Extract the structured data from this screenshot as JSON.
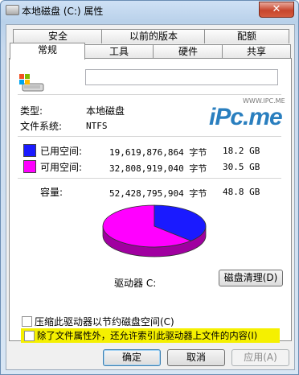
{
  "window": {
    "title": "本地磁盘 (C:) 属性",
    "close_glyph": "✕"
  },
  "tabs_row1": [
    "安全",
    "以前的版本",
    "配额"
  ],
  "tabs_row2": [
    "常规",
    "工具",
    "硬件",
    "共享"
  ],
  "general": {
    "name_value": "",
    "type_label": "类型:",
    "type_value": "本地磁盘",
    "fs_label": "文件系统:",
    "fs_value": "NTFS",
    "used_label": "已用空间:",
    "used_bytes": "19,619,876,864 字节",
    "used_gb": "18.2 GB",
    "free_label": "可用空间:",
    "free_bytes": "32,808,919,040 字节",
    "free_gb": "30.5 GB",
    "cap_label": "容量:",
    "cap_bytes": "52,428,795,904 字节",
    "cap_gb": "48.8 GB",
    "drive_label": "驱动器 C:",
    "cleanup_button": "磁盘清理(D)",
    "compress_label": "压缩此驱动器以节约磁盘空间(C)",
    "index_label": "除了文件属性外，还允许索引此驱动器上文件的内容(I)",
    "used_fraction": 0.374,
    "used_color": "#1a1aff",
    "free_color": "#ff00ff"
  },
  "watermark": {
    "url": "WWW.IPC.ME",
    "logo": "iPc.me"
  },
  "footer": {
    "ok": "确定",
    "cancel": "取消",
    "apply": "应用(A)"
  },
  "icons": [
    "drive-icon",
    "close-icon",
    "window-icon"
  ]
}
